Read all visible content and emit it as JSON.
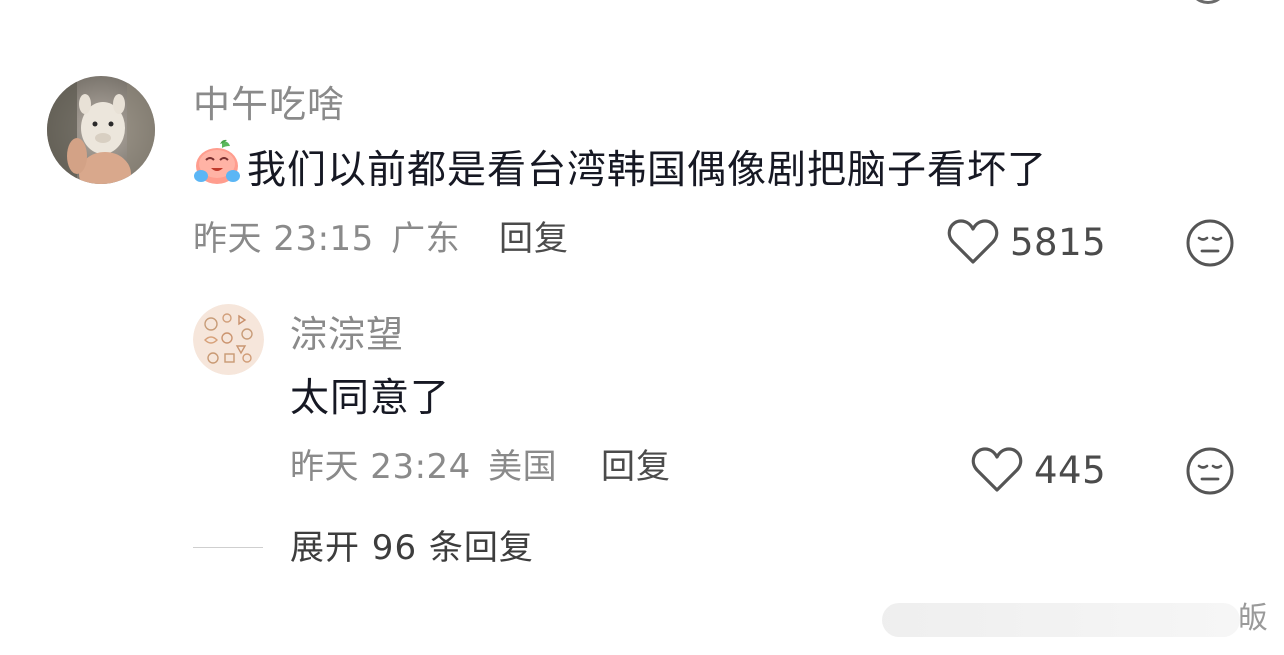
{
  "comments": [
    {
      "username": "中午吃啥",
      "emoji": "crying-laughing-emoji",
      "text": "我们以前都是看台湾韩国偶像剧把脑子看坏了",
      "time": "昨天 23:15",
      "location": "广东",
      "reply_label": "回复",
      "likes": "5815",
      "icons": {
        "like": "heart-outline-icon",
        "dislike": "neutral-face-icon"
      }
    }
  ],
  "replies": [
    {
      "username": "淙淙望",
      "text": "太同意了",
      "time": "昨天 23:24",
      "location": "美国",
      "reply_label": "回复",
      "likes": "445",
      "icons": {
        "like": "heart-outline-icon",
        "dislike": "neutral-face-icon"
      }
    }
  ],
  "expand": {
    "label": "展开 96 条回复"
  },
  "watermark": {
    "text": "皈"
  },
  "colors": {
    "primary_text": "#161823",
    "secondary_text": "#8a8a8a",
    "action_text": "#4b4b4b"
  }
}
